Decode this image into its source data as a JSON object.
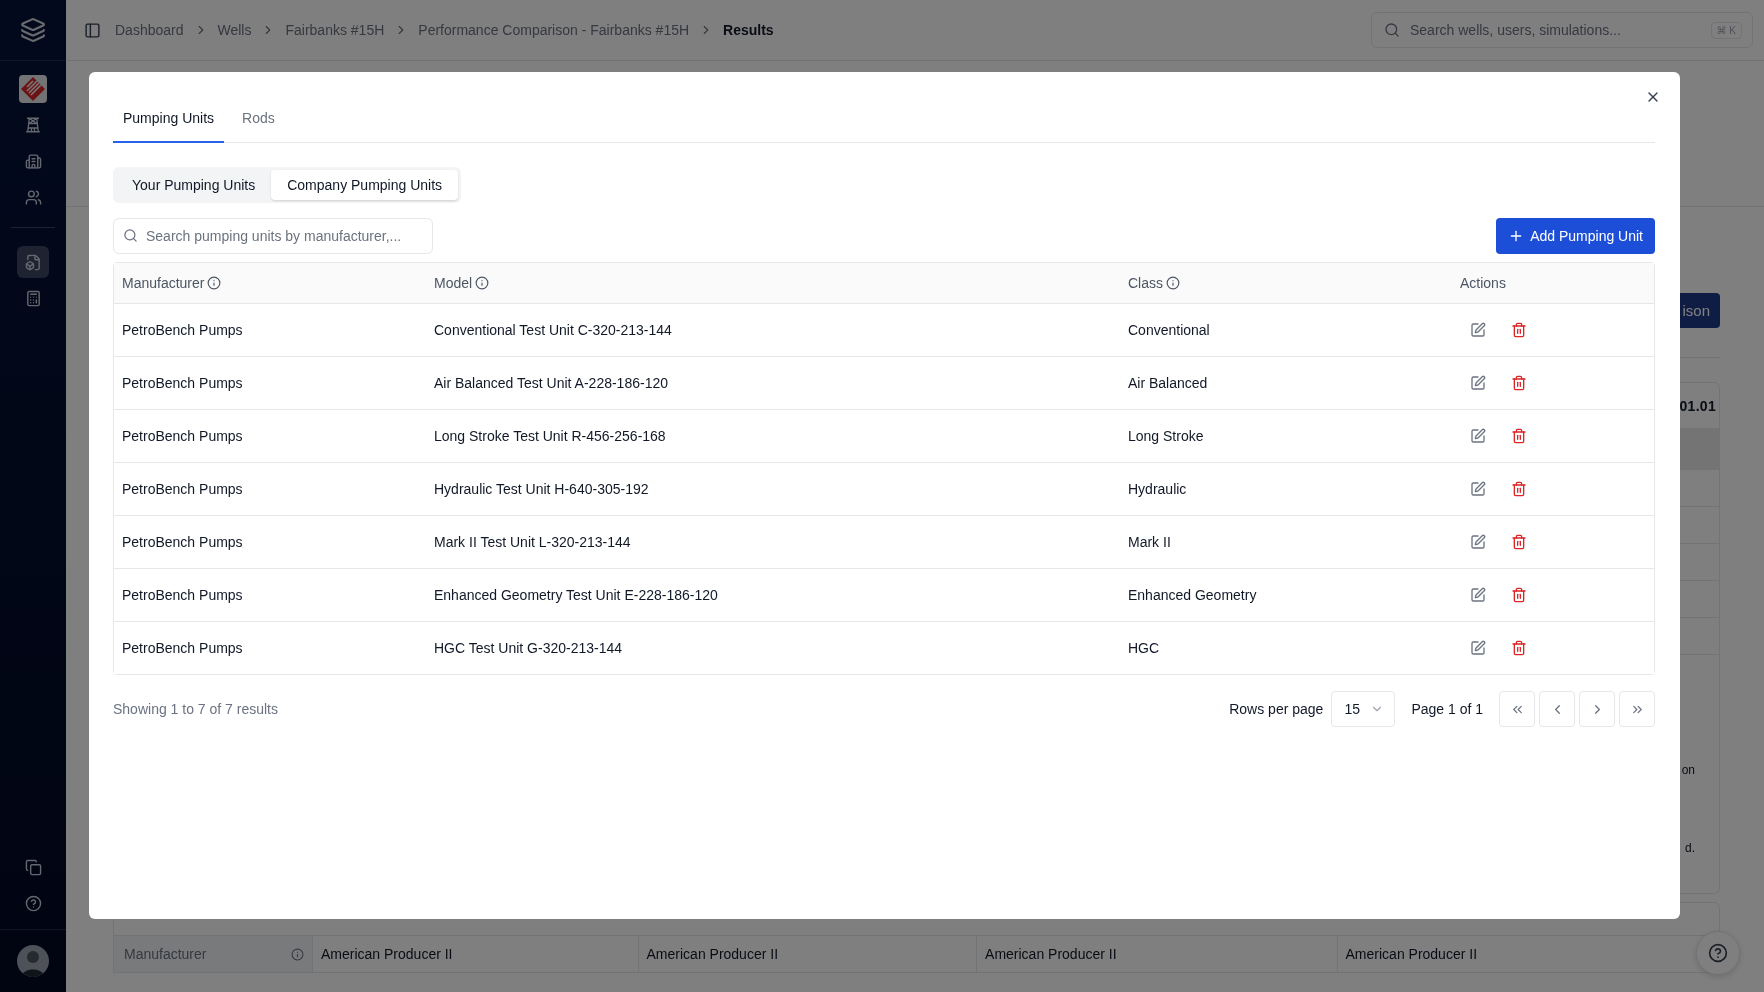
{
  "sidebar": {
    "items": [
      {
        "kind": "brand",
        "selected": false
      },
      {
        "kind": "derrick",
        "selected": false
      },
      {
        "kind": "building",
        "selected": false
      },
      {
        "kind": "users",
        "selected": false
      },
      {
        "kind": "file",
        "selected": true
      },
      {
        "kind": "calculator",
        "selected": false
      }
    ],
    "footer_items": [
      {
        "kind": "copy"
      },
      {
        "kind": "help"
      }
    ]
  },
  "breadcrumbs": [
    {
      "label": "Dashboard",
      "current": false
    },
    {
      "label": "Wells",
      "current": false
    },
    {
      "label": "Fairbanks #15H",
      "current": false
    },
    {
      "label": "Performance Comparison - Fairbanks #15H",
      "current": false
    },
    {
      "label": "Results",
      "current": true
    }
  ],
  "search": {
    "placeholder": "Search wells, users, simulations...",
    "shortcut": "⌘ K"
  },
  "background": {
    "action_button": "ison",
    "card_value": "01.01",
    "notes": [
      "on",
      "d."
    ],
    "rows": [
      {
        "label": "Manufacturer",
        "values": [
          "American Producer II",
          "American Producer II",
          "American Producer II",
          "American Producer II"
        ]
      }
    ]
  },
  "modal": {
    "tabs": [
      {
        "label": "Pumping Units",
        "selected": true
      },
      {
        "label": "Rods",
        "selected": false
      }
    ],
    "segments": [
      {
        "label": "Your Pumping Units",
        "selected": false
      },
      {
        "label": "Company Pumping Units",
        "selected": true
      }
    ],
    "search": {
      "placeholder": "Search pumping units by manufacturer,..."
    },
    "add_button": "Add Pumping Unit",
    "table": {
      "columns": [
        {
          "label": "Manufacturer",
          "info": true
        },
        {
          "label": "Model",
          "info": true
        },
        {
          "label": "Class",
          "info": true
        },
        {
          "label": "Actions",
          "info": false
        }
      ],
      "rows": [
        {
          "manufacturer": "PetroBench Pumps",
          "model": "Conventional Test Unit C-320-213-144",
          "class": "Conventional"
        },
        {
          "manufacturer": "PetroBench Pumps",
          "model": "Air Balanced Test Unit A-228-186-120",
          "class": "Air Balanced"
        },
        {
          "manufacturer": "PetroBench Pumps",
          "model": "Long Stroke Test Unit R-456-256-168",
          "class": "Long Stroke"
        },
        {
          "manufacturer": "PetroBench Pumps",
          "model": "Hydraulic Test Unit H-640-305-192",
          "class": "Hydraulic"
        },
        {
          "manufacturer": "PetroBench Pumps",
          "model": "Mark II Test Unit L-320-213-144",
          "class": "Mark II"
        },
        {
          "manufacturer": "PetroBench Pumps",
          "model": "Enhanced Geometry Test Unit E-228-186-120",
          "class": "Enhanced Geometry"
        },
        {
          "manufacturer": "PetroBench Pumps",
          "model": "HGC Test Unit G-320-213-144",
          "class": "HGC"
        }
      ]
    },
    "footer": {
      "summary": "Showing 1 to 7 of 7 results",
      "rows_per_page_label": "Rows per page",
      "rows_per_page": "15",
      "page": "Page 1 of 1"
    }
  }
}
